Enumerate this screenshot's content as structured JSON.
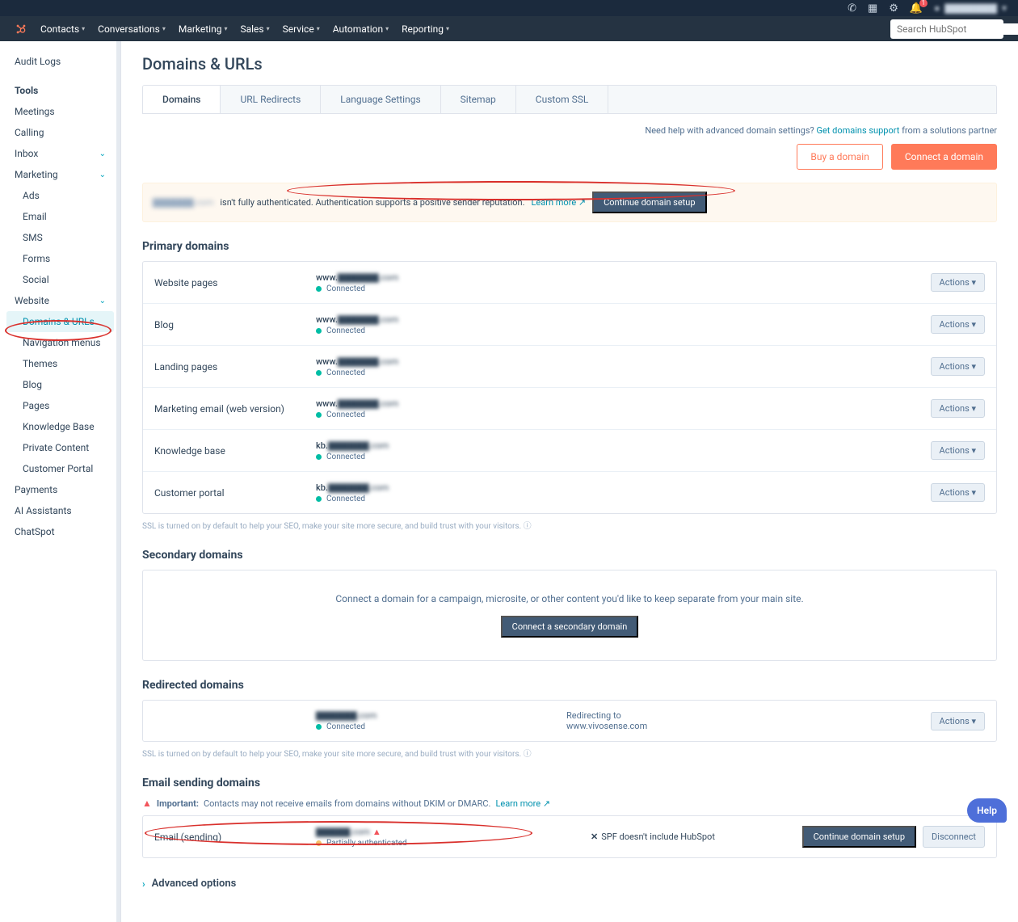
{
  "topbar": {
    "user": "▇▇▇▇▇▇▇"
  },
  "nav": {
    "items": [
      "Contacts",
      "Conversations",
      "Marketing",
      "Sales",
      "Service",
      "Automation",
      "Reporting"
    ],
    "search_placeholder": "Search HubSpot"
  },
  "sidebar": {
    "audit": "Audit Logs",
    "tools": "Tools",
    "items1": [
      "Meetings",
      "Calling"
    ],
    "inbox": "Inbox",
    "marketing": "Marketing",
    "mkitems": [
      "Ads",
      "Email",
      "SMS",
      "Forms",
      "Social"
    ],
    "website": "Website",
    "wsitems": [
      "Domains & URLs",
      "Navigation menus",
      "Themes",
      "Blog",
      "Pages",
      "Knowledge Base",
      "Private Content",
      "Customer Portal"
    ],
    "items2": [
      "Payments",
      "AI Assistants",
      "ChatSpot"
    ]
  },
  "page": {
    "title": "Domains & URLs",
    "tabs": [
      "Domains",
      "URL Redirects",
      "Language Settings",
      "Sitemap",
      "Custom SSL"
    ],
    "help_pre": "Need help with advanced domain settings? ",
    "help_link": "Get domains support",
    "help_post": " from a solutions partner",
    "buy": "Buy a domain",
    "connect": "Connect a domain"
  },
  "alert": {
    "domain": "▇▇▇▇▇▇.com",
    "text": " isn't fully authenticated. Authentication supports a positive sender reputation. ",
    "learn": "Learn more",
    "btn": "Continue domain setup"
  },
  "primary": {
    "heading": "Primary domains",
    "rows": [
      {
        "label": "Website pages",
        "prefix": "www.",
        "domain": "▇▇▇▇▇▇.com",
        "status": "Connected"
      },
      {
        "label": "Blog",
        "prefix": "www.",
        "domain": "▇▇▇▇▇▇.com",
        "status": "Connected"
      },
      {
        "label": "Landing pages",
        "prefix": "www.",
        "domain": "▇▇▇▇▇▇.com",
        "status": "Connected"
      },
      {
        "label": "Marketing email (web version)",
        "prefix": "www.",
        "domain": "▇▇▇▇▇▇.com",
        "status": "Connected"
      },
      {
        "label": "Knowledge base",
        "prefix": "kb.",
        "domain": "▇▇▇▇▇▇.com",
        "status": "Connected"
      },
      {
        "label": "Customer portal",
        "prefix": "kb.",
        "domain": "▇▇▇▇▇▇.com",
        "status": "Connected"
      }
    ],
    "actions": "Actions",
    "note": "SSL is turned on by default to help your SEO, make your site more secure, and build trust with your visitors. "
  },
  "secondary": {
    "heading": "Secondary domains",
    "text": "Connect a domain for a campaign, microsite, or other content you'd like to keep separate from your main site.",
    "btn": "Connect a secondary domain"
  },
  "redirected": {
    "heading": "Redirected domains",
    "domain": "▇▇▇▇▇▇.com",
    "status": "Connected",
    "redir_label": "Redirecting to",
    "redir_value": "www.vivosense.com",
    "actions": "Actions",
    "note": "SSL is turned on by default to help your SEO, make your site more secure, and build trust with your visitors. "
  },
  "email": {
    "heading": "Email sending domains",
    "warn_strong": "Important:",
    "warn_text": " Contacts may not receive emails from domains without DKIM or DMARC. ",
    "warn_link": "Learn more",
    "label": "Email (sending)",
    "domain": "▇▇▇▇▇.com",
    "status": "Partially authenticated",
    "spf": "SPF doesn't include HubSpot",
    "btn1": "Continue domain setup",
    "btn2": "Disconnect"
  },
  "adv": "Advanced options",
  "help": "Help"
}
